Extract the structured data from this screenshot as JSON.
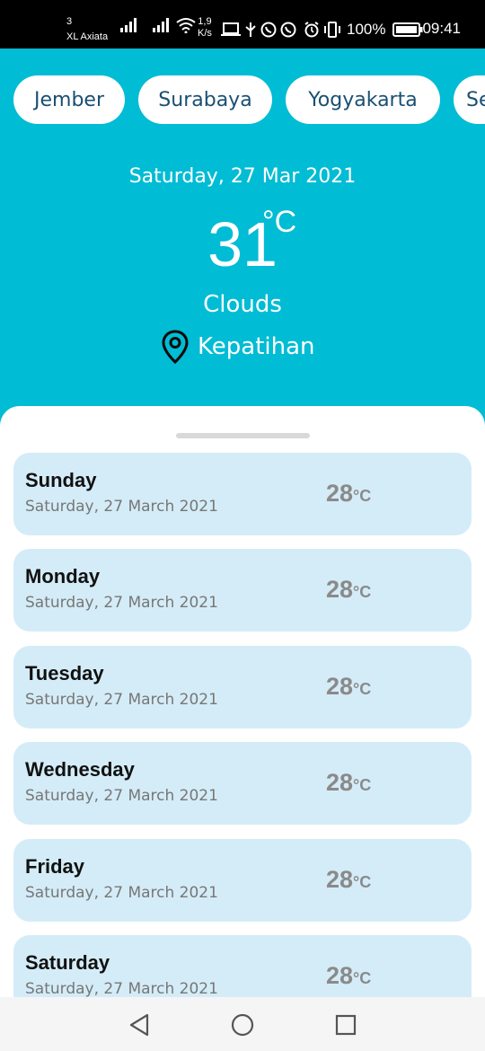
{
  "status_bar": {
    "carrier_number": "3",
    "carrier": "XL Axiata",
    "speed_value": "1,9",
    "speed_unit": "K/s",
    "battery": "100%",
    "time": "09:41"
  },
  "cities": [
    "Jember",
    "Surabaya",
    "Yogyakarta",
    "Semarang"
  ],
  "current": {
    "date": "Saturday, 27 Mar 2021",
    "temperature": "31",
    "unit": "°C",
    "condition": "Clouds",
    "location": "Kepatihan"
  },
  "forecast": [
    {
      "day": "Sunday",
      "date": "Saturday, 27 March 2021",
      "temp": "28",
      "unit": "°C"
    },
    {
      "day": "Monday",
      "date": "Saturday, 27 March 2021",
      "temp": "28",
      "unit": "°C"
    },
    {
      "day": "Tuesday",
      "date": "Saturday, 27 March 2021",
      "temp": "28",
      "unit": "°C"
    },
    {
      "day": "Wednesday",
      "date": "Saturday, 27 March 2021",
      "temp": "28",
      "unit": "°C"
    },
    {
      "day": "Friday",
      "date": "Saturday, 27 March 2021",
      "temp": "28",
      "unit": "°C"
    },
    {
      "day": "Saturday",
      "date": "Saturday, 27 March 2021",
      "temp": "28",
      "unit": "°C"
    }
  ],
  "colors": {
    "header_bg": "#00bcd4",
    "card_bg": "#d4ecf7",
    "chip_text": "#1a4f73"
  },
  "icons": {
    "location": "map-pin-icon",
    "nav_back": "back-triangle-icon",
    "nav_home": "home-circle-icon",
    "nav_recents": "recents-square-icon"
  }
}
